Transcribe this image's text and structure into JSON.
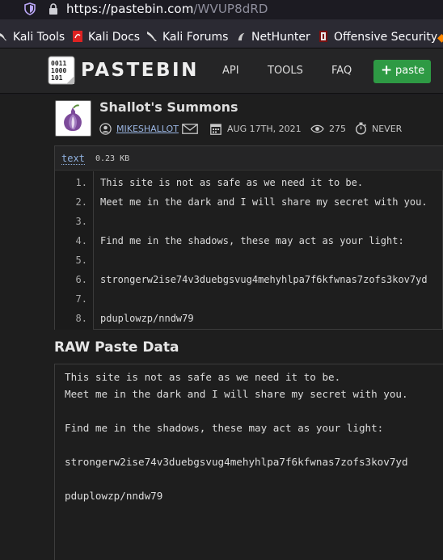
{
  "browser": {
    "url_domain": "https://pastebin.com",
    "url_path": "/WVUP8dRD",
    "bookmarks": [
      {
        "label": "Kali Tools",
        "icon": "kali-dragon-icon"
      },
      {
        "label": "Kali Docs",
        "icon": "kali-docs-icon"
      },
      {
        "label": "Kali Forums",
        "icon": "kali-forums-icon"
      },
      {
        "label": "NetHunter",
        "icon": "nethunter-icon"
      },
      {
        "label": "Offensive Security",
        "icon": "offsec-icon"
      }
    ]
  },
  "header": {
    "logo_text": "PASTEBIN",
    "logo_icon_text": [
      "0011",
      "1000",
      "101"
    ],
    "nav": [
      "API",
      "TOOLS",
      "FAQ"
    ],
    "add_label": "paste",
    "add_color": "#2e9a44"
  },
  "paste": {
    "title": "Shallot's Summons",
    "author": "MIKESHALLOT",
    "date": "AUG 17TH, 2021",
    "views": "275",
    "expiry": "NEVER",
    "syntax": "text",
    "size": "0.23 KB",
    "lines": [
      {
        "num": "1.",
        "text": "This site is not as safe as we need it to be."
      },
      {
        "num": "2.",
        "text": "Meet me in the dark and I will share my secret with you."
      },
      {
        "num": "3.",
        "text": ""
      },
      {
        "num": "4.",
        "text": "Find me in the shadows, these may act as your light:"
      },
      {
        "num": "5.",
        "text": ""
      },
      {
        "num": "6.",
        "text": "strongerw2ise74v3duebgsvug4mehyhlpa7f6kfwnas7zofs3kov7yd"
      },
      {
        "num": "7.",
        "text": ""
      },
      {
        "num": "8.",
        "text": "pduplowzp/nndw79"
      }
    ]
  },
  "raw": {
    "heading": "RAW Paste Data",
    "lines": [
      "This site is not as safe as we need it to be.",
      "Meet me in the dark and I will share my secret with you.",
      "",
      "Find me in the shadows, these may act as your light:",
      "",
      "strongerw2ise74v3duebgsvug4mehyhlpa7f6kfwnas7zofs3kov7yd",
      "",
      "pduplowzp/nndw79"
    ]
  }
}
